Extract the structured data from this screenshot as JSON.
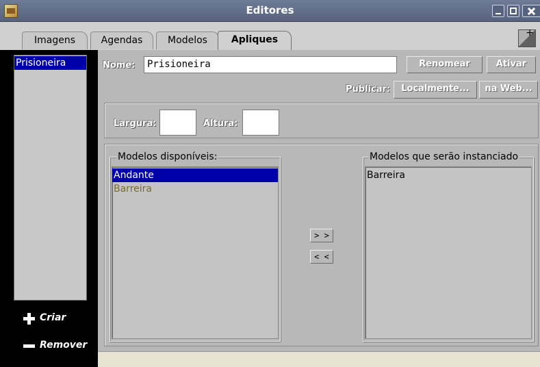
{
  "window": {
    "title": "Editores"
  },
  "tabs": [
    {
      "label": "Imagens"
    },
    {
      "label": "Agendas"
    },
    {
      "label": "Modelos"
    },
    {
      "label": "Apliques",
      "active": true
    }
  ],
  "sidebar": {
    "items": [
      {
        "label": "Prisioneira",
        "selected": true
      }
    ],
    "criar_label": "Criar",
    "remover_label": "Remover"
  },
  "form": {
    "nome_label": "Nome:",
    "nome_value": "Prisioneira",
    "renomear_label": "Renomear",
    "ativar_label": "Ativar",
    "publicar_label": "Publicar:",
    "localmente_label": "Localmente...",
    "naweb_label": "na Web...",
    "largura_label": "Largura:",
    "largura_value": "",
    "altura_label": "Altura:",
    "altura_value": ""
  },
  "models": {
    "available_title": "Modelos disponíveis:",
    "available": [
      {
        "label": "Andante",
        "selected": true
      },
      {
        "label": "Barreira",
        "selected": false
      }
    ],
    "selected_title": "Modelos que serão instanciado",
    "selected": [
      {
        "label": "Barreira"
      }
    ],
    "add_label": "> >",
    "remove_label": "< <"
  },
  "colors": {
    "selection": "#0000a8",
    "sidebar_bg": "#000000",
    "panel_bg": "#b8b8b8",
    "titlebar": "#5e6a86"
  }
}
